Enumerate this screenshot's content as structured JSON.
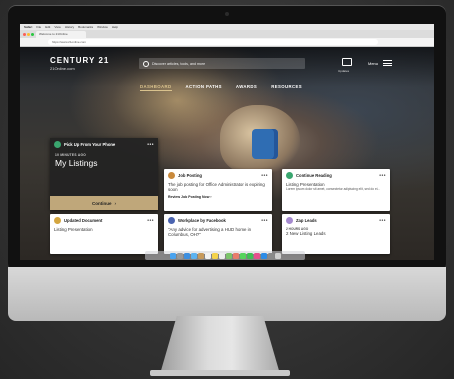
{
  "mac_menu": [
    "Safari",
    "File",
    "Edit",
    "View",
    "History",
    "Bookmarks",
    "Window",
    "Help"
  ],
  "browser": {
    "tab_title": "Welcome to 21Online",
    "url": "https://www.21online.com"
  },
  "brand": {
    "name": "CENTURY 21",
    "sub": "21Online.com"
  },
  "search": {
    "placeholder": "Discover articles, tools, and more"
  },
  "header": {
    "notifications_label": "Updates",
    "menu_label": "Menu"
  },
  "nav": [
    {
      "label": "DASHBOARD"
    },
    {
      "label": "ACTION PATHS"
    },
    {
      "label": "AWARDS"
    },
    {
      "label": "RESOURCES"
    }
  ],
  "cards": {
    "pickup": {
      "title": "Pick Up From Your Phone",
      "time": "10 MINUTES AGO",
      "heading": "My Listings",
      "button": "Continue",
      "more": "•••"
    },
    "job": {
      "title": "Job Posting",
      "body": "The job posting for Office Administrator is expiring soon",
      "link": "Review Job Posting Now",
      "more": "•••"
    },
    "reading": {
      "title": "Continue Reading",
      "body": "Listing Presentation",
      "small": "Lorem ipsum dolor sit amet, consectetur adipiscing elit, sed do ei...",
      "more": "•••"
    },
    "doc": {
      "title": "Updated Document",
      "body": "Listing Presentation",
      "more": "•••"
    },
    "facebook": {
      "title": "Workplace by Facebook",
      "body": "\"Any advice for advertising a HUD home in Columbus, OH?\"",
      "more": "•••"
    },
    "zap": {
      "title": "Zap Leads",
      "time": "2 HOURS AGO",
      "body": "2 New Listing Leads",
      "more": "•••"
    }
  },
  "colors": {
    "accent_gold": "#bfa77a",
    "job_icon": "#c98a3c",
    "reading_icon": "#3aa66f",
    "doc_icon": "#d4a640",
    "facebook_icon": "#4b64b0",
    "zap_icon": "#a58acf"
  },
  "icons": {
    "search": "search-icon",
    "notifications": "inbox-icon",
    "menu": "hamburger-icon",
    "chevron": "chevron-right-icon"
  }
}
